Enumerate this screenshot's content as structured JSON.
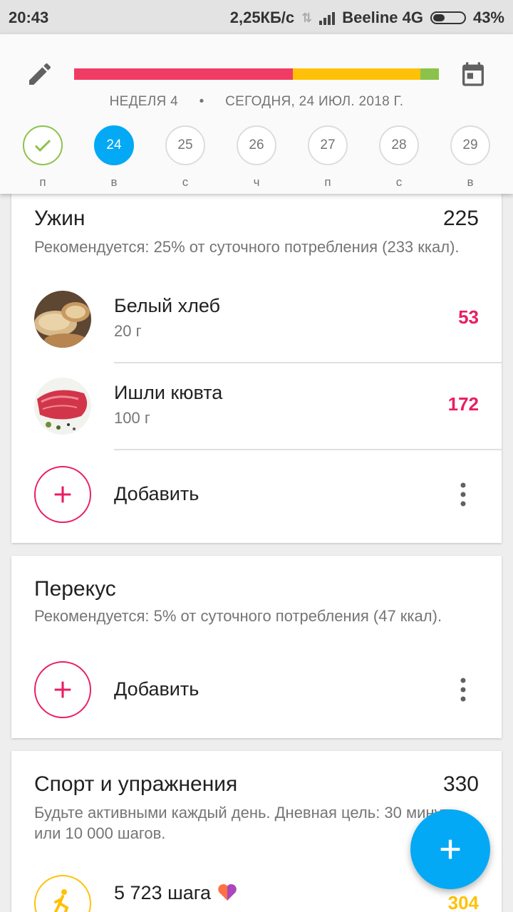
{
  "status_bar": {
    "time": "20:43",
    "speed": "2,25КБ/с",
    "carrier": "Beeline 4G",
    "battery": "43%",
    "battery_level": 0.43
  },
  "header": {
    "week": "НЕДЕЛЯ 4",
    "separator": "•",
    "today": "СЕГОДНЯ, 24 ИЮЛ. 2018 Г.",
    "progress": [
      {
        "color": "#f03c64",
        "fraction": 0.6
      },
      {
        "color": "#ffc107",
        "fraction": 0.35
      },
      {
        "color": "#8bc34a",
        "fraction": 0.05
      }
    ],
    "days": [
      {
        "num": "",
        "label": "п",
        "state": "done"
      },
      {
        "num": "24",
        "label": "в",
        "state": "active"
      },
      {
        "num": "25",
        "label": "с",
        "state": "normal"
      },
      {
        "num": "26",
        "label": "ч",
        "state": "normal"
      },
      {
        "num": "27",
        "label": "п",
        "state": "normal"
      },
      {
        "num": "28",
        "label": "с",
        "state": "normal"
      },
      {
        "num": "29",
        "label": "в",
        "state": "normal"
      }
    ]
  },
  "dinner": {
    "title": "Ужин",
    "total": "225",
    "subtitle": "Рекомендуется: 25% от суточного потребления (233 ккал).",
    "items": [
      {
        "name": "Белый хлеб",
        "amount": "20 г",
        "kcal": "53",
        "image": "bread-image"
      },
      {
        "name": "Ишли кювта",
        "amount": "100 г",
        "kcal": "172",
        "image": "meat-image"
      }
    ],
    "add_label": "Добавить"
  },
  "snack": {
    "title": "Перекус",
    "subtitle": "Рекомендуется: 5% от суточного потребления (47 ккал).",
    "add_label": "Добавить"
  },
  "sport": {
    "title": "Спорт и упражнения",
    "total": "330",
    "subtitle": "Будьте активными каждый день. Дневная цель: 30 минут или 10 000 шагов.",
    "steps_label": "5 723 шага",
    "steps_kcal": "304"
  },
  "colors": {
    "accent": "#03a9f4",
    "pink": "#e91e63",
    "green": "#8bc34a",
    "yellow": "#ffc107"
  }
}
